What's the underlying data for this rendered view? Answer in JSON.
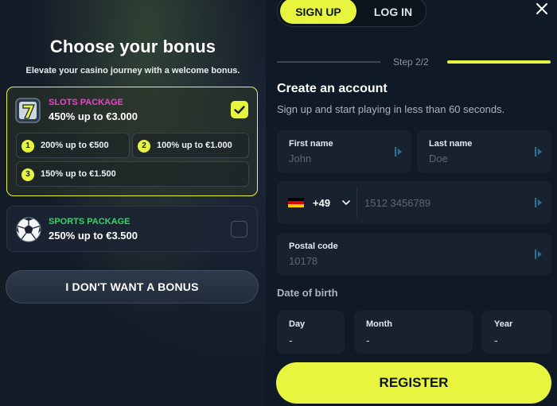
{
  "colors": {
    "accent": "#e8f53f",
    "slots": "#e647c9",
    "sports": "#36d667",
    "bg": "#101a27"
  },
  "bonus": {
    "title": "Choose your bonus",
    "subtitle": "Elevate your casino journey with a welcome bonus.",
    "slots": {
      "name": "SLOTS PACKAGE",
      "offer": "450% up to €3.000",
      "selected": true,
      "icon": "slot-seven-icon",
      "tiers": [
        {
          "num": "1",
          "text": "200% up to €500"
        },
        {
          "num": "2",
          "text": "100% up to €1.000"
        },
        {
          "num": "3",
          "text": "150% up to €1.500"
        }
      ]
    },
    "sports": {
      "name": "SPORTS PACKAGE",
      "offer": "250% up to €3.500",
      "selected": false,
      "icon": "soccer-ball-icon"
    },
    "no_bonus_label": "I DON'T WANT A BONUS"
  },
  "auth": {
    "tab_signup": "SIGN UP",
    "tab_login": "LOG IN",
    "close_icon": "close-icon",
    "step": "Step 2/2",
    "title": "Create an account",
    "subtitle": "Sign up and start playing in less than 60 seconds.",
    "first_name": {
      "label": "First name",
      "placeholder": "John"
    },
    "last_name": {
      "label": "Last name",
      "placeholder": "Doe"
    },
    "phone": {
      "country_code": "+49",
      "placeholder": "1512 3456789",
      "flag": "germany-flag-icon"
    },
    "postal": {
      "label": "Postal code",
      "placeholder": "10178"
    },
    "dob": {
      "title": "Date of birth",
      "day": {
        "label": "Day",
        "value": "-"
      },
      "month": {
        "label": "Month",
        "value": "-"
      },
      "year": {
        "label": "Year",
        "value": "-"
      }
    },
    "register_label": "REGISTER"
  }
}
